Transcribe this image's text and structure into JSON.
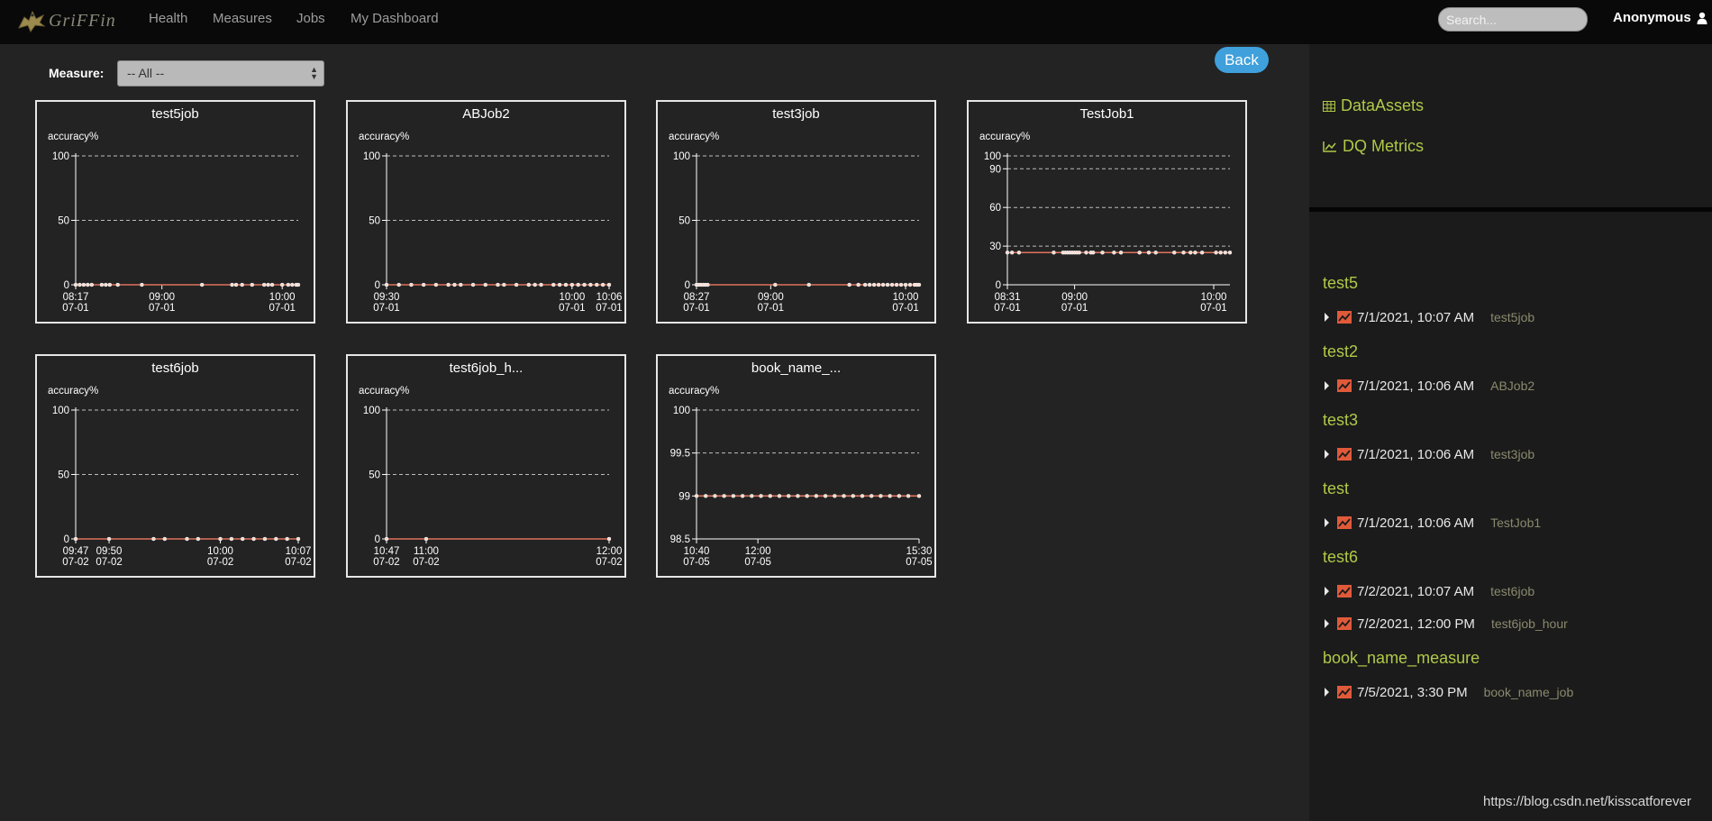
{
  "nav": {
    "brand": "GriFFin",
    "links": [
      "Health",
      "Measures",
      "Jobs",
      "My Dashboard"
    ],
    "search_placeholder": "Search...",
    "user": "Anonymous",
    "user_icon": "user-icon"
  },
  "filter": {
    "label": "Measure:",
    "selected": "-- All --",
    "back_label": "Back"
  },
  "sidebar": {
    "data_assets": "DataAssets",
    "dq_metrics": "DQ Metrics",
    "groups": [
      {
        "title": "test5",
        "entries": [
          {
            "time": "7/1/2021, 10:07 AM",
            "job": "test5job"
          }
        ]
      },
      {
        "title": "test2",
        "entries": [
          {
            "time": "7/1/2021, 10:06 AM",
            "job": "ABJob2"
          }
        ]
      },
      {
        "title": "test3",
        "entries": [
          {
            "time": "7/1/2021, 10:06 AM",
            "job": "test3job"
          }
        ]
      },
      {
        "title": "test",
        "entries": [
          {
            "time": "7/1/2021, 10:06 AM",
            "job": "TestJob1"
          }
        ]
      },
      {
        "title": "test6",
        "entries": [
          {
            "time": "7/2/2021, 10:07 AM",
            "job": "test6job"
          },
          {
            "time": "7/2/2021, 12:00 PM",
            "job": "test6job_hour"
          }
        ]
      },
      {
        "title": "book_name_measure",
        "entries": [
          {
            "time": "7/5/2021, 3:30 PM",
            "job": "book_name_job"
          }
        ]
      }
    ]
  },
  "footer_url": "https://blog.csdn.net/kisscatforever",
  "colors": {
    "accent": "#b0c948",
    "line": "#e0735a",
    "back_button": "#3fa0dc"
  },
  "chart_data": [
    {
      "type": "line",
      "title": "test5job",
      "ylabel": "accuracy%",
      "ylim": [
        0,
        100
      ],
      "yticks": [
        0,
        50,
        100
      ],
      "xticks": [
        {
          "t": 497,
          "time": "08:17",
          "date": "07-01"
        },
        {
          "t": 540,
          "time": "09:00",
          "date": "07-01"
        },
        {
          "t": 600,
          "time": "10:00",
          "date": "07-01"
        }
      ],
      "xrange": [
        497,
        608
      ],
      "series": [
        {
          "x": [
            497,
            499,
            501,
            503,
            505,
            510,
            512,
            514,
            518,
            530,
            560,
            575,
            577,
            580,
            585,
            591,
            593,
            595,
            600,
            603,
            605,
            607,
            608
          ],
          "y": [
            0,
            0,
            0,
            0,
            0,
            0,
            0,
            0,
            0,
            0,
            0,
            0,
            0,
            0,
            0,
            0,
            0,
            0,
            0,
            0,
            0,
            0,
            0
          ]
        }
      ]
    },
    {
      "type": "line",
      "title": "ABJob2",
      "ylabel": "accuracy%",
      "ylim": [
        0,
        100
      ],
      "yticks": [
        0,
        50,
        100
      ],
      "xticks": [
        {
          "t": 570,
          "time": "09:30",
          "date": "07-01"
        },
        {
          "t": 600,
          "time": "10:00",
          "date": "07-01"
        },
        {
          "t": 606,
          "time": "10:06",
          "date": "07-01"
        }
      ],
      "xrange": [
        570,
        606
      ],
      "series": [
        {
          "x": [
            570,
            572,
            574,
            576,
            578,
            580,
            581,
            582,
            584,
            586,
            588,
            589,
            591,
            593,
            594,
            595,
            597,
            598,
            599,
            600,
            601,
            602,
            603,
            604,
            605,
            606
          ],
          "y": [
            0,
            0,
            0,
            0,
            0,
            0,
            0,
            0,
            0,
            0,
            0,
            0,
            0,
            0,
            0,
            0,
            0,
            0,
            0,
            0,
            0,
            0,
            0,
            0,
            0,
            0
          ]
        }
      ]
    },
    {
      "type": "line",
      "title": "test3job",
      "ylabel": "accuracy%",
      "ylim": [
        0,
        100
      ],
      "yticks": [
        0,
        50,
        100
      ],
      "xticks": [
        {
          "t": 507,
          "time": "08:27",
          "date": "07-01"
        },
        {
          "t": 540,
          "time": "09:00",
          "date": "07-01"
        },
        {
          "t": 600,
          "time": "10:00",
          "date": "07-01"
        }
      ],
      "xrange": [
        507,
        606
      ],
      "series": [
        {
          "x": [
            507,
            508,
            509,
            510,
            511,
            512,
            542,
            557,
            575,
            579,
            582,
            584,
            586,
            588,
            590,
            592,
            594,
            596,
            598,
            600,
            602,
            604,
            605,
            606
          ],
          "y": [
            0,
            0,
            0,
            0,
            0,
            0,
            0,
            0,
            0,
            0,
            0,
            0,
            0,
            0,
            0,
            0,
            0,
            0,
            0,
            0,
            0,
            0,
            0,
            0
          ]
        }
      ]
    },
    {
      "type": "line",
      "title": "TestJob1",
      "ylabel": "accuracy%",
      "ylim": [
        0,
        100
      ],
      "yticks": [
        0,
        30,
        60,
        90,
        100
      ],
      "xticks": [
        {
          "t": 511,
          "time": "08:31",
          "date": "07-01"
        },
        {
          "t": 540,
          "time": "09:00",
          "date": "07-01"
        },
        {
          "t": 600,
          "time": "10:00",
          "date": "07-01"
        }
      ],
      "xrange": [
        511,
        607
      ],
      "series": [
        {
          "x": [
            511,
            513,
            516,
            531,
            535,
            536,
            537,
            538,
            539,
            540,
            541,
            542,
            545,
            547,
            548,
            552,
            557,
            560,
            568,
            572,
            575,
            583,
            587,
            590,
            592,
            595,
            601,
            603,
            605,
            607
          ],
          "y": [
            25,
            25,
            25,
            25,
            25,
            25,
            25,
            25,
            25,
            25,
            25,
            25,
            25,
            25,
            25,
            25,
            25,
            25,
            25,
            25,
            25,
            25,
            25,
            25,
            25,
            25,
            25,
            25,
            25,
            25
          ]
        }
      ]
    },
    {
      "type": "line",
      "title": "test6job",
      "ylabel": "accuracy%",
      "ylim": [
        0,
        100
      ],
      "yticks": [
        0,
        50,
        100
      ],
      "xticks": [
        {
          "t": 587,
          "time": "09:47",
          "date": "07-02"
        },
        {
          "t": 590,
          "time": "09:50",
          "date": "07-02"
        },
        {
          "t": 600,
          "time": "10:00",
          "date": "07-02"
        },
        {
          "t": 607,
          "time": "10:07",
          "date": "07-02"
        }
      ],
      "xrange": [
        587,
        607
      ],
      "series": [
        {
          "x": [
            587,
            590,
            594,
            595,
            597,
            598,
            600,
            601,
            602,
            603,
            604,
            605,
            606,
            607
          ],
          "y": [
            0,
            0,
            0,
            0,
            0,
            0,
            0,
            0,
            0,
            0,
            0,
            0,
            0,
            0
          ]
        }
      ]
    },
    {
      "type": "line",
      "title": "test6job_h...",
      "ylabel": "accuracy%",
      "ylim": [
        0,
        100
      ],
      "yticks": [
        0,
        50,
        100
      ],
      "xticks": [
        {
          "t": 647,
          "time": "10:47",
          "date": "07-02"
        },
        {
          "t": 660,
          "time": "11:00",
          "date": "07-02"
        },
        {
          "t": 720,
          "time": "12:00",
          "date": "07-02"
        }
      ],
      "xrange": [
        647,
        720
      ],
      "series": [
        {
          "x": [
            647,
            660,
            720
          ],
          "y": [
            0,
            0,
            0
          ]
        }
      ]
    },
    {
      "type": "line",
      "title": "book_name_...",
      "ylabel": "accuracy%",
      "ylim": [
        98.5,
        100
      ],
      "yticks": [
        98.5,
        99,
        99.5,
        100
      ],
      "xticks": [
        {
          "t": 640,
          "time": "10:40",
          "date": "07-05"
        },
        {
          "t": 720,
          "time": "12:00",
          "date": "07-05"
        },
        {
          "t": 930,
          "time": "15:30",
          "date": "07-05"
        }
      ],
      "xrange": [
        640,
        930
      ],
      "series": [
        {
          "x": [
            640,
            652,
            664,
            676,
            688,
            700,
            712,
            724,
            736,
            748,
            760,
            772,
            784,
            796,
            808,
            820,
            832,
            844,
            856,
            868,
            880,
            892,
            904,
            916,
            930
          ],
          "y": [
            99,
            99,
            99,
            99,
            99,
            99,
            99,
            99,
            99,
            99,
            99,
            99,
            99,
            99,
            99,
            99,
            99,
            99,
            99,
            99,
            99,
            99,
            99,
            99,
            99
          ]
        }
      ]
    }
  ]
}
